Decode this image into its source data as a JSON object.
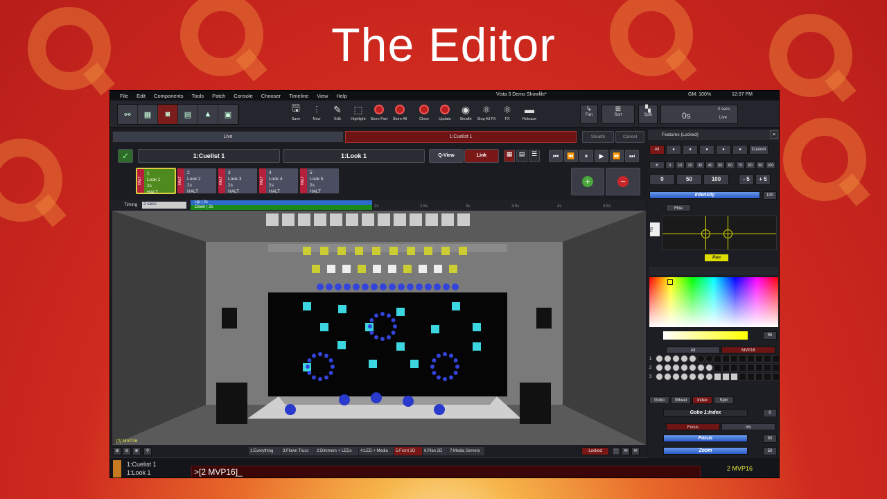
{
  "slide_title": "The Editor",
  "menu": [
    "File",
    "Edit",
    "Components",
    "Tools",
    "Patch",
    "Console",
    "Chooser",
    "Timeline",
    "View",
    "Help"
  ],
  "window_title": "Vista 3 Demo Showfile*",
  "status": {
    "gm": "GM: 100%",
    "clock": "12:07 PM"
  },
  "tools": [
    {
      "label": "Save",
      "icon": "save-icon"
    },
    {
      "label": "New",
      "icon": "faders-icon"
    },
    {
      "label": "Edit",
      "icon": "edit-icon"
    },
    {
      "label": "Highlight",
      "icon": "highlight-icon"
    },
    {
      "label": "Store Part",
      "icon": "record-icon"
    },
    {
      "label": "Store All",
      "icon": "record-icon"
    },
    {
      "label": "Close",
      "icon": "close-icon"
    },
    {
      "label": "Update",
      "icon": "record-icon"
    },
    {
      "label": "Stealth",
      "icon": "eye-icon"
    },
    {
      "label": "Stop All FX",
      "icon": "atom-icon"
    },
    {
      "label": "FX",
      "icon": "atom-icon"
    },
    {
      "label": "Release",
      "icon": "release-icon"
    }
  ],
  "right_tools": {
    "fan": "Fan",
    "sort": "Sort",
    "split": "Split",
    "time": "0s",
    "secs": "0 secs",
    "live": "Live"
  },
  "live_label": "Live",
  "playback_label": "1:Cuelist 1",
  "stealth": "Stealth",
  "cancel": "Cancel",
  "cuelist_name": "1:Cuelist 1",
  "look_name": "1:Look 1",
  "qview": "Q-View",
  "link": "Link",
  "cues": [
    {
      "num": "1",
      "name": "Look 1",
      "time": "2s",
      "state": "HALT",
      "selected": true
    },
    {
      "num": "2",
      "name": "Look 2",
      "time": "2s",
      "state": "HALT",
      "selected": false
    },
    {
      "num": "3",
      "name": "Look 3",
      "time": "2s",
      "state": "HALT",
      "selected": false
    },
    {
      "num": "4",
      "name": "Look 4",
      "time": "2s",
      "state": "HALT",
      "selected": false
    },
    {
      "num": "5",
      "name": "Look 5",
      "time": "2s",
      "state": "HALT",
      "selected": false
    }
  ],
  "halt_label": "HALT",
  "timing": {
    "label": "Timing",
    "value": "2 secs",
    "up": "Up | 2s",
    "down": "Down | 2s",
    "ticks": [
      "2s",
      "2.5s",
      "3s",
      "3.5s",
      "4s",
      "4.5s"
    ]
  },
  "stage_label": "[2] MVP16",
  "view_tabs": [
    "1:Everything",
    "3:Flown Truss",
    "2:Dimmers + LEDs",
    "4:LED + Media",
    "5:Front 3D",
    "6:Plan 2D",
    "7:Media Servers"
  ],
  "active_view": "5:Front 3D",
  "locked": "Locked",
  "cmd_lines": [
    "1:Cuelist 1",
    "1:Look 1"
  ],
  "cmd_prompt": ">[2 MVP16]_",
  "selection": "2 MVP16",
  "features": {
    "header": "Features (Locked)",
    "all": "All",
    "custom": "Custom",
    "levels": [
      "0",
      "10",
      "20",
      "30",
      "40",
      "50",
      "60",
      "70",
      "80",
      "90",
      "100"
    ],
    "quick": [
      "0",
      "50",
      "100",
      "- 5",
      "+ 5"
    ],
    "intensity": "Intensity",
    "intensity_val": "100",
    "fine": "Fine",
    "tilt": "Tilt",
    "pan": "Pan",
    "color_val": "95",
    "gobo_tabs": [
      "All",
      "MVP16"
    ],
    "gobo_rows": [
      "1",
      "2",
      "3"
    ],
    "gobo_buttons": [
      "Gobo",
      "Wheel",
      "Index",
      "Spin"
    ],
    "gobo_index": "Gobo 1:Index",
    "gobo_index_val": "0",
    "focus_tabs": [
      "Focus",
      "Iris"
    ],
    "focus": "Focus",
    "focus_val": "50",
    "zoom": "Zoom",
    "zoom_val": "50"
  }
}
